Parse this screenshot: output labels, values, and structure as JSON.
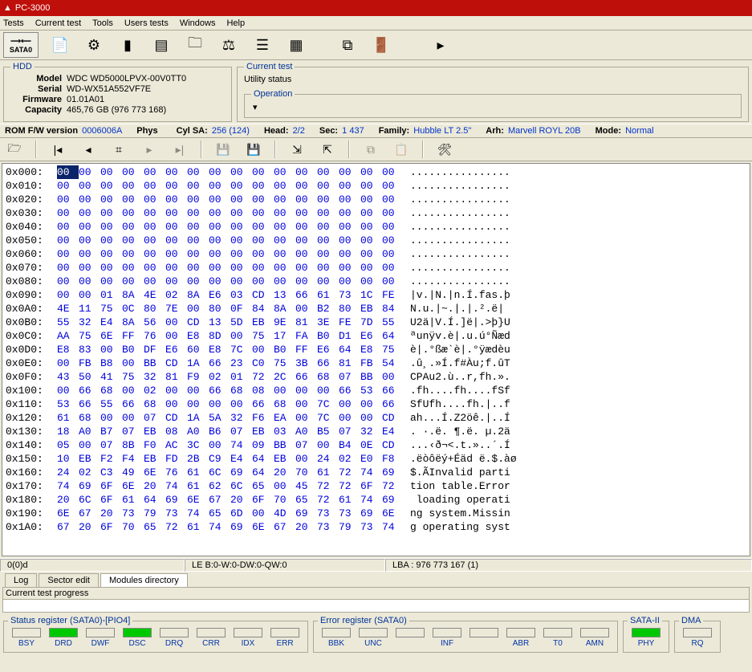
{
  "title": "PC-3000",
  "menu": [
    "Tests",
    "Current test",
    "Tools",
    "Users tests",
    "Windows",
    "Help"
  ],
  "sata_btn": {
    "arrows": "⟶⟵",
    "label": "SATA0"
  },
  "hdd": {
    "legend": "HDD",
    "model_lbl": "Model",
    "model": "WDC WD5000LPVX-00V0TT0",
    "serial_lbl": "Serial",
    "serial": "WD-WX51A552VF7E",
    "fw_lbl": "Firmware",
    "fw": "01.01A01",
    "cap_lbl": "Capacity",
    "cap": "465,76 GB (976 773 168)"
  },
  "current_test": {
    "legend": "Current test",
    "utility": "Utility status",
    "op_label": "Operation",
    "op_dropdown": "▾"
  },
  "info": {
    "rom_lbl": "ROM F/W version",
    "rom": "0006006A",
    "phys": "Phys",
    "cylsa_lbl": "Cyl SA:",
    "cylsa": "256 (124)",
    "head_lbl": "Head:",
    "head": "2/2",
    "sec_lbl": "Sec:",
    "sec": "1 437",
    "family_lbl": "Family:",
    "family": "Hubble LT 2.5\"",
    "arh_lbl": "Arh:",
    "arh": "Marvell ROYL 20B",
    "mode_lbl": "Mode:",
    "mode": "Normal"
  },
  "hex": {
    "rows": [
      {
        "a": "0x000:",
        "selFirst": true,
        "b": [
          "00",
          "00",
          "00",
          "00",
          "00",
          "00",
          "00",
          "00",
          "00",
          "00",
          "00",
          "00",
          "00",
          "00",
          "00",
          "00"
        ],
        "t": "................"
      },
      {
        "a": "0x010:",
        "b": [
          "00",
          "00",
          "00",
          "00",
          "00",
          "00",
          "00",
          "00",
          "00",
          "00",
          "00",
          "00",
          "00",
          "00",
          "00",
          "00"
        ],
        "t": "................"
      },
      {
        "a": "0x020:",
        "b": [
          "00",
          "00",
          "00",
          "00",
          "00",
          "00",
          "00",
          "00",
          "00",
          "00",
          "00",
          "00",
          "00",
          "00",
          "00",
          "00"
        ],
        "t": "................"
      },
      {
        "a": "0x030:",
        "b": [
          "00",
          "00",
          "00",
          "00",
          "00",
          "00",
          "00",
          "00",
          "00",
          "00",
          "00",
          "00",
          "00",
          "00",
          "00",
          "00"
        ],
        "t": "................"
      },
      {
        "a": "0x040:",
        "b": [
          "00",
          "00",
          "00",
          "00",
          "00",
          "00",
          "00",
          "00",
          "00",
          "00",
          "00",
          "00",
          "00",
          "00",
          "00",
          "00"
        ],
        "t": "................"
      },
      {
        "a": "0x050:",
        "b": [
          "00",
          "00",
          "00",
          "00",
          "00",
          "00",
          "00",
          "00",
          "00",
          "00",
          "00",
          "00",
          "00",
          "00",
          "00",
          "00"
        ],
        "t": "................"
      },
      {
        "a": "0x060:",
        "b": [
          "00",
          "00",
          "00",
          "00",
          "00",
          "00",
          "00",
          "00",
          "00",
          "00",
          "00",
          "00",
          "00",
          "00",
          "00",
          "00"
        ],
        "t": "................"
      },
      {
        "a": "0x070:",
        "b": [
          "00",
          "00",
          "00",
          "00",
          "00",
          "00",
          "00",
          "00",
          "00",
          "00",
          "00",
          "00",
          "00",
          "00",
          "00",
          "00"
        ],
        "t": "................"
      },
      {
        "a": "0x080:",
        "b": [
          "00",
          "00",
          "00",
          "00",
          "00",
          "00",
          "00",
          "00",
          "00",
          "00",
          "00",
          "00",
          "00",
          "00",
          "00",
          "00"
        ],
        "t": "................"
      },
      {
        "a": "0x090:",
        "b": [
          "00",
          "00",
          "01",
          "8A",
          "4E",
          "02",
          "8A",
          "E6",
          "03",
          "CD",
          "13",
          "66",
          "61",
          "73",
          "1C",
          "FE"
        ],
        "t": "|v.|N.|n.Í.fas.þ"
      },
      {
        "a": "0x0A0:",
        "b": [
          "4E",
          "11",
          "75",
          "0C",
          "80",
          "7E",
          "00",
          "80",
          "0F",
          "84",
          "8A",
          "00",
          "B2",
          "80",
          "EB",
          "84"
        ],
        "t": "N.u.|~.|.|.².ë|"
      },
      {
        "a": "0x0B0:",
        "b": [
          "55",
          "32",
          "E4",
          "8A",
          "56",
          "00",
          "CD",
          "13",
          "5D",
          "EB",
          "9E",
          "81",
          "3E",
          "FE",
          "7D",
          "55"
        ],
        "t": "U2ä|V.Í.]ë|.>þ}U"
      },
      {
        "a": "0x0C0:",
        "b": [
          "AA",
          "75",
          "6E",
          "FF",
          "76",
          "00",
          "E8",
          "8D",
          "00",
          "75",
          "17",
          "FA",
          "B0",
          "D1",
          "E6",
          "64"
        ],
        "t": "ªunÿv.è|.u.ú°Ñæd"
      },
      {
        "a": "0x0D0:",
        "b": [
          "E8",
          "83",
          "00",
          "B0",
          "DF",
          "E6",
          "60",
          "E8",
          "7C",
          "00",
          "B0",
          "FF",
          "E6",
          "64",
          "E8",
          "75"
        ],
        "t": "è|.°ßæ`è|.°ÿædèu"
      },
      {
        "a": "0x0E0:",
        "b": [
          "00",
          "FB",
          "B8",
          "00",
          "BB",
          "CD",
          "1A",
          "66",
          "23",
          "C0",
          "75",
          "3B",
          "66",
          "81",
          "FB",
          "54"
        ],
        "t": ".û¸.»Í.f#Àu;f.ûT"
      },
      {
        "a": "0x0F0:",
        "b": [
          "43",
          "50",
          "41",
          "75",
          "32",
          "81",
          "F9",
          "02",
          "01",
          "72",
          "2C",
          "66",
          "68",
          "07",
          "BB",
          "00"
        ],
        "t": "CPAu2.ù..r,fh.»."
      },
      {
        "a": "0x100:",
        "b": [
          "00",
          "66",
          "68",
          "00",
          "02",
          "00",
          "00",
          "66",
          "68",
          "08",
          "00",
          "00",
          "00",
          "66",
          "53",
          "66"
        ],
        "t": ".fh....fh....fSf"
      },
      {
        "a": "0x110:",
        "b": [
          "53",
          "66",
          "55",
          "66",
          "68",
          "00",
          "00",
          "00",
          "00",
          "66",
          "68",
          "00",
          "7C",
          "00",
          "00",
          "66"
        ],
        "t": "SfUfh....fh.|..f"
      },
      {
        "a": "0x120:",
        "b": [
          "61",
          "68",
          "00",
          "00",
          "07",
          "CD",
          "1A",
          "5A",
          "32",
          "F6",
          "EA",
          "00",
          "7C",
          "00",
          "00",
          "CD"
        ],
        "t": "ah...Í.Z2öê.|..Í"
      },
      {
        "a": "0x130:",
        "b": [
          "18",
          "A0",
          "B7",
          "07",
          "EB",
          "08",
          "A0",
          "B6",
          "07",
          "EB",
          "03",
          "A0",
          "B5",
          "07",
          "32",
          "E4"
        ],
        "t": ". ·.ë. ¶.ë. µ.2ä"
      },
      {
        "a": "0x140:",
        "b": [
          "05",
          "00",
          "07",
          "8B",
          "F0",
          "AC",
          "3C",
          "00",
          "74",
          "09",
          "BB",
          "07",
          "00",
          "B4",
          "0E",
          "CD"
        ],
        "t": "...‹ð¬<.t.»..´.Í"
      },
      {
        "a": "0x150:",
        "b": [
          "10",
          "EB",
          "F2",
          "F4",
          "EB",
          "FD",
          "2B",
          "C9",
          "E4",
          "64",
          "EB",
          "00",
          "24",
          "02",
          "E0",
          "F8"
        ],
        "t": ".ëòôëý+Éäd ë.$.àø"
      },
      {
        "a": "0x160:",
        "b": [
          "24",
          "02",
          "C3",
          "49",
          "6E",
          "76",
          "61",
          "6C",
          "69",
          "64",
          "20",
          "70",
          "61",
          "72",
          "74",
          "69"
        ],
        "t": "$.ÃInvalid parti"
      },
      {
        "a": "0x170:",
        "b": [
          "74",
          "69",
          "6F",
          "6E",
          "20",
          "74",
          "61",
          "62",
          "6C",
          "65",
          "00",
          "45",
          "72",
          "72",
          "6F",
          "72"
        ],
        "t": "tion table.Error"
      },
      {
        "a": "0x180:",
        "b": [
          "20",
          "6C",
          "6F",
          "61",
          "64",
          "69",
          "6E",
          "67",
          "20",
          "6F",
          "70",
          "65",
          "72",
          "61",
          "74",
          "69"
        ],
        "t": " loading operati"
      },
      {
        "a": "0x190:",
        "b": [
          "6E",
          "67",
          "20",
          "73",
          "79",
          "73",
          "74",
          "65",
          "6D",
          "00",
          "4D",
          "69",
          "73",
          "73",
          "69",
          "6E"
        ],
        "t": "ng system.Missin"
      },
      {
        "a": "0x1A0:",
        "b": [
          "67",
          "20",
          "6F",
          "70",
          "65",
          "72",
          "61",
          "74",
          "69",
          "6E",
          "67",
          "20",
          "73",
          "79",
          "73",
          "74"
        ],
        "t": "g operating syst"
      }
    ]
  },
  "status": {
    "cell1": "0(0)d",
    "cell2": "LE B:0-W:0-DW:0-QW:0",
    "cell3": "LBA : 976 773 167 (1)"
  },
  "tabs": [
    "Log",
    "Sector edit",
    "Modules directory"
  ],
  "active_tab": 2,
  "progress_label": "Current test progress",
  "regs": {
    "status": {
      "legend": "Status register (SATA0)-[PIO4]",
      "flags": [
        {
          "n": "BSY",
          "on": false
        },
        {
          "n": "DRD",
          "on": true
        },
        {
          "n": "DWF",
          "on": false
        },
        {
          "n": "DSC",
          "on": true
        },
        {
          "n": "DRQ",
          "on": false
        },
        {
          "n": "CRR",
          "on": false
        },
        {
          "n": "IDX",
          "on": false
        },
        {
          "n": "ERR",
          "on": false
        }
      ]
    },
    "error": {
      "legend": "Error register (SATA0)",
      "flags": [
        {
          "n": "BBK",
          "on": false
        },
        {
          "n": "UNC",
          "on": false
        },
        {
          "n": "",
          "on": false
        },
        {
          "n": "INF",
          "on": false
        },
        {
          "n": "",
          "on": false
        },
        {
          "n": "ABR",
          "on": false
        },
        {
          "n": "T0",
          "on": false
        },
        {
          "n": "AMN",
          "on": false
        }
      ]
    },
    "sata2": {
      "legend": "SATA-II",
      "flags": [
        {
          "n": "PHY",
          "on": true
        }
      ]
    },
    "dma": {
      "legend": "DMA",
      "flags": [
        {
          "n": "RQ",
          "on": false
        }
      ]
    }
  }
}
